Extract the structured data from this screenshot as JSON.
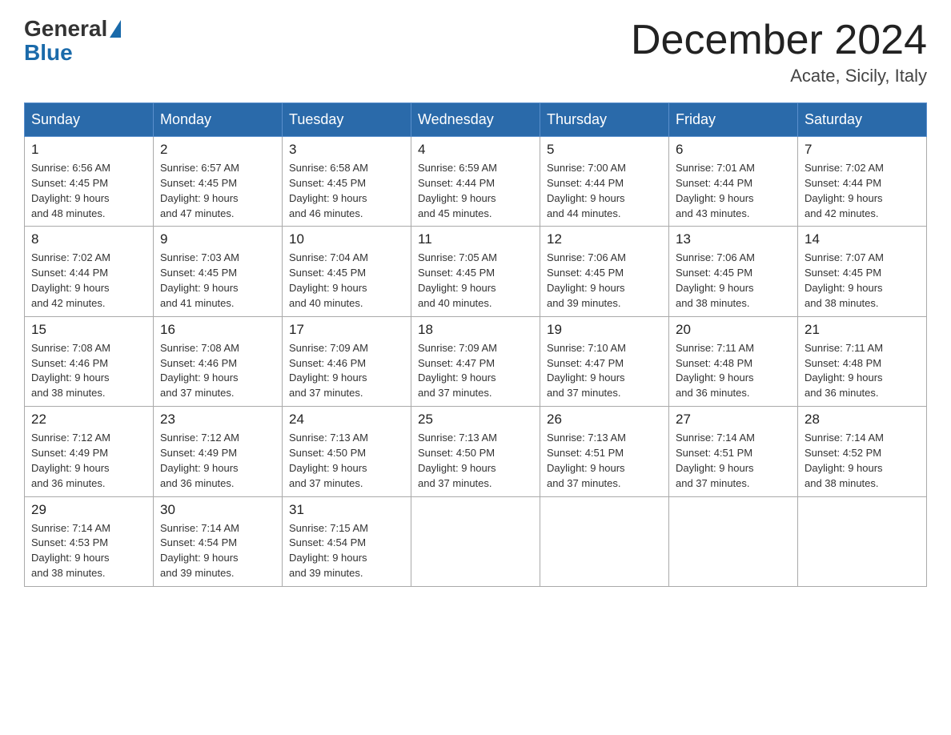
{
  "header": {
    "logo_general": "General",
    "logo_blue": "Blue",
    "title": "December 2024",
    "subtitle": "Acate, Sicily, Italy"
  },
  "columns": [
    "Sunday",
    "Monday",
    "Tuesday",
    "Wednesday",
    "Thursday",
    "Friday",
    "Saturday"
  ],
  "weeks": [
    [
      {
        "day": "1",
        "sunrise": "6:56 AM",
        "sunset": "4:45 PM",
        "daylight": "9 hours and 48 minutes."
      },
      {
        "day": "2",
        "sunrise": "6:57 AM",
        "sunset": "4:45 PM",
        "daylight": "9 hours and 47 minutes."
      },
      {
        "day": "3",
        "sunrise": "6:58 AM",
        "sunset": "4:45 PM",
        "daylight": "9 hours and 46 minutes."
      },
      {
        "day": "4",
        "sunrise": "6:59 AM",
        "sunset": "4:44 PM",
        "daylight": "9 hours and 45 minutes."
      },
      {
        "day": "5",
        "sunrise": "7:00 AM",
        "sunset": "4:44 PM",
        "daylight": "9 hours and 44 minutes."
      },
      {
        "day": "6",
        "sunrise": "7:01 AM",
        "sunset": "4:44 PM",
        "daylight": "9 hours and 43 minutes."
      },
      {
        "day": "7",
        "sunrise": "7:02 AM",
        "sunset": "4:44 PM",
        "daylight": "9 hours and 42 minutes."
      }
    ],
    [
      {
        "day": "8",
        "sunrise": "7:02 AM",
        "sunset": "4:44 PM",
        "daylight": "9 hours and 42 minutes."
      },
      {
        "day": "9",
        "sunrise": "7:03 AM",
        "sunset": "4:45 PM",
        "daylight": "9 hours and 41 minutes."
      },
      {
        "day": "10",
        "sunrise": "7:04 AM",
        "sunset": "4:45 PM",
        "daylight": "9 hours and 40 minutes."
      },
      {
        "day": "11",
        "sunrise": "7:05 AM",
        "sunset": "4:45 PM",
        "daylight": "9 hours and 40 minutes."
      },
      {
        "day": "12",
        "sunrise": "7:06 AM",
        "sunset": "4:45 PM",
        "daylight": "9 hours and 39 minutes."
      },
      {
        "day": "13",
        "sunrise": "7:06 AM",
        "sunset": "4:45 PM",
        "daylight": "9 hours and 38 minutes."
      },
      {
        "day": "14",
        "sunrise": "7:07 AM",
        "sunset": "4:45 PM",
        "daylight": "9 hours and 38 minutes."
      }
    ],
    [
      {
        "day": "15",
        "sunrise": "7:08 AM",
        "sunset": "4:46 PM",
        "daylight": "9 hours and 38 minutes."
      },
      {
        "day": "16",
        "sunrise": "7:08 AM",
        "sunset": "4:46 PM",
        "daylight": "9 hours and 37 minutes."
      },
      {
        "day": "17",
        "sunrise": "7:09 AM",
        "sunset": "4:46 PM",
        "daylight": "9 hours and 37 minutes."
      },
      {
        "day": "18",
        "sunrise": "7:09 AM",
        "sunset": "4:47 PM",
        "daylight": "9 hours and 37 minutes."
      },
      {
        "day": "19",
        "sunrise": "7:10 AM",
        "sunset": "4:47 PM",
        "daylight": "9 hours and 37 minutes."
      },
      {
        "day": "20",
        "sunrise": "7:11 AM",
        "sunset": "4:48 PM",
        "daylight": "9 hours and 36 minutes."
      },
      {
        "day": "21",
        "sunrise": "7:11 AM",
        "sunset": "4:48 PM",
        "daylight": "9 hours and 36 minutes."
      }
    ],
    [
      {
        "day": "22",
        "sunrise": "7:12 AM",
        "sunset": "4:49 PM",
        "daylight": "9 hours and 36 minutes."
      },
      {
        "day": "23",
        "sunrise": "7:12 AM",
        "sunset": "4:49 PM",
        "daylight": "9 hours and 36 minutes."
      },
      {
        "day": "24",
        "sunrise": "7:13 AM",
        "sunset": "4:50 PM",
        "daylight": "9 hours and 37 minutes."
      },
      {
        "day": "25",
        "sunrise": "7:13 AM",
        "sunset": "4:50 PM",
        "daylight": "9 hours and 37 minutes."
      },
      {
        "day": "26",
        "sunrise": "7:13 AM",
        "sunset": "4:51 PM",
        "daylight": "9 hours and 37 minutes."
      },
      {
        "day": "27",
        "sunrise": "7:14 AM",
        "sunset": "4:51 PM",
        "daylight": "9 hours and 37 minutes."
      },
      {
        "day": "28",
        "sunrise": "7:14 AM",
        "sunset": "4:52 PM",
        "daylight": "9 hours and 38 minutes."
      }
    ],
    [
      {
        "day": "29",
        "sunrise": "7:14 AM",
        "sunset": "4:53 PM",
        "daylight": "9 hours and 38 minutes."
      },
      {
        "day": "30",
        "sunrise": "7:14 AM",
        "sunset": "4:54 PM",
        "daylight": "9 hours and 39 minutes."
      },
      {
        "day": "31",
        "sunrise": "7:15 AM",
        "sunset": "4:54 PM",
        "daylight": "9 hours and 39 minutes."
      },
      null,
      null,
      null,
      null
    ]
  ],
  "labels": {
    "sunrise": "Sunrise: ",
    "sunset": "Sunset: ",
    "daylight": "Daylight: "
  }
}
